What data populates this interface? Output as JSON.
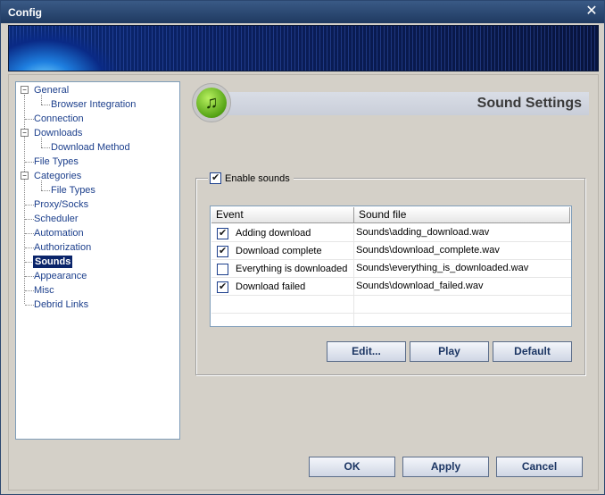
{
  "window": {
    "title": "Config",
    "close_glyph": "✕"
  },
  "tree": {
    "items": [
      {
        "label": "General"
      },
      {
        "label": "Browser Integration"
      },
      {
        "label": "Connection"
      },
      {
        "label": "Downloads"
      },
      {
        "label": "Download Method"
      },
      {
        "label": "File Types"
      },
      {
        "label": "Categories"
      },
      {
        "label": "File Types"
      },
      {
        "label": "Proxy/Socks"
      },
      {
        "label": "Scheduler"
      },
      {
        "label": "Automation"
      },
      {
        "label": "Authorization"
      },
      {
        "label": "Sounds",
        "selected": true
      },
      {
        "label": "Appearance"
      },
      {
        "label": "Misc"
      },
      {
        "label": "Debrid Links"
      }
    ],
    "toggle_glyph": "−"
  },
  "panel": {
    "title": "Sound Settings",
    "icon": "music-note-icon",
    "icon_glyph": "♫"
  },
  "enable_sounds": {
    "label": "Enable sounds",
    "checked": true
  },
  "sound_list": {
    "columns": [
      "Event",
      "Sound file"
    ],
    "rows": [
      {
        "checked": true,
        "event": "Adding download",
        "file": "Sounds\\adding_download.wav"
      },
      {
        "checked": true,
        "event": "Download complete",
        "file": "Sounds\\download_complete.wav"
      },
      {
        "checked": false,
        "event": "Everything is downloaded",
        "file": "Sounds\\everything_is_downloaded.wav"
      },
      {
        "checked": true,
        "event": "Download failed",
        "file": "Sounds\\download_failed.wav"
      }
    ]
  },
  "buttons": {
    "edit": "Edit...",
    "play": "Play",
    "default": "Default",
    "ok": "OK",
    "apply": "Apply",
    "cancel": "Cancel"
  },
  "colors": {
    "titlebar": "#1f3a61",
    "selection": "#0a246a",
    "link_text": "#1c3f8c",
    "dialog_bg": "#d4d0c8"
  }
}
